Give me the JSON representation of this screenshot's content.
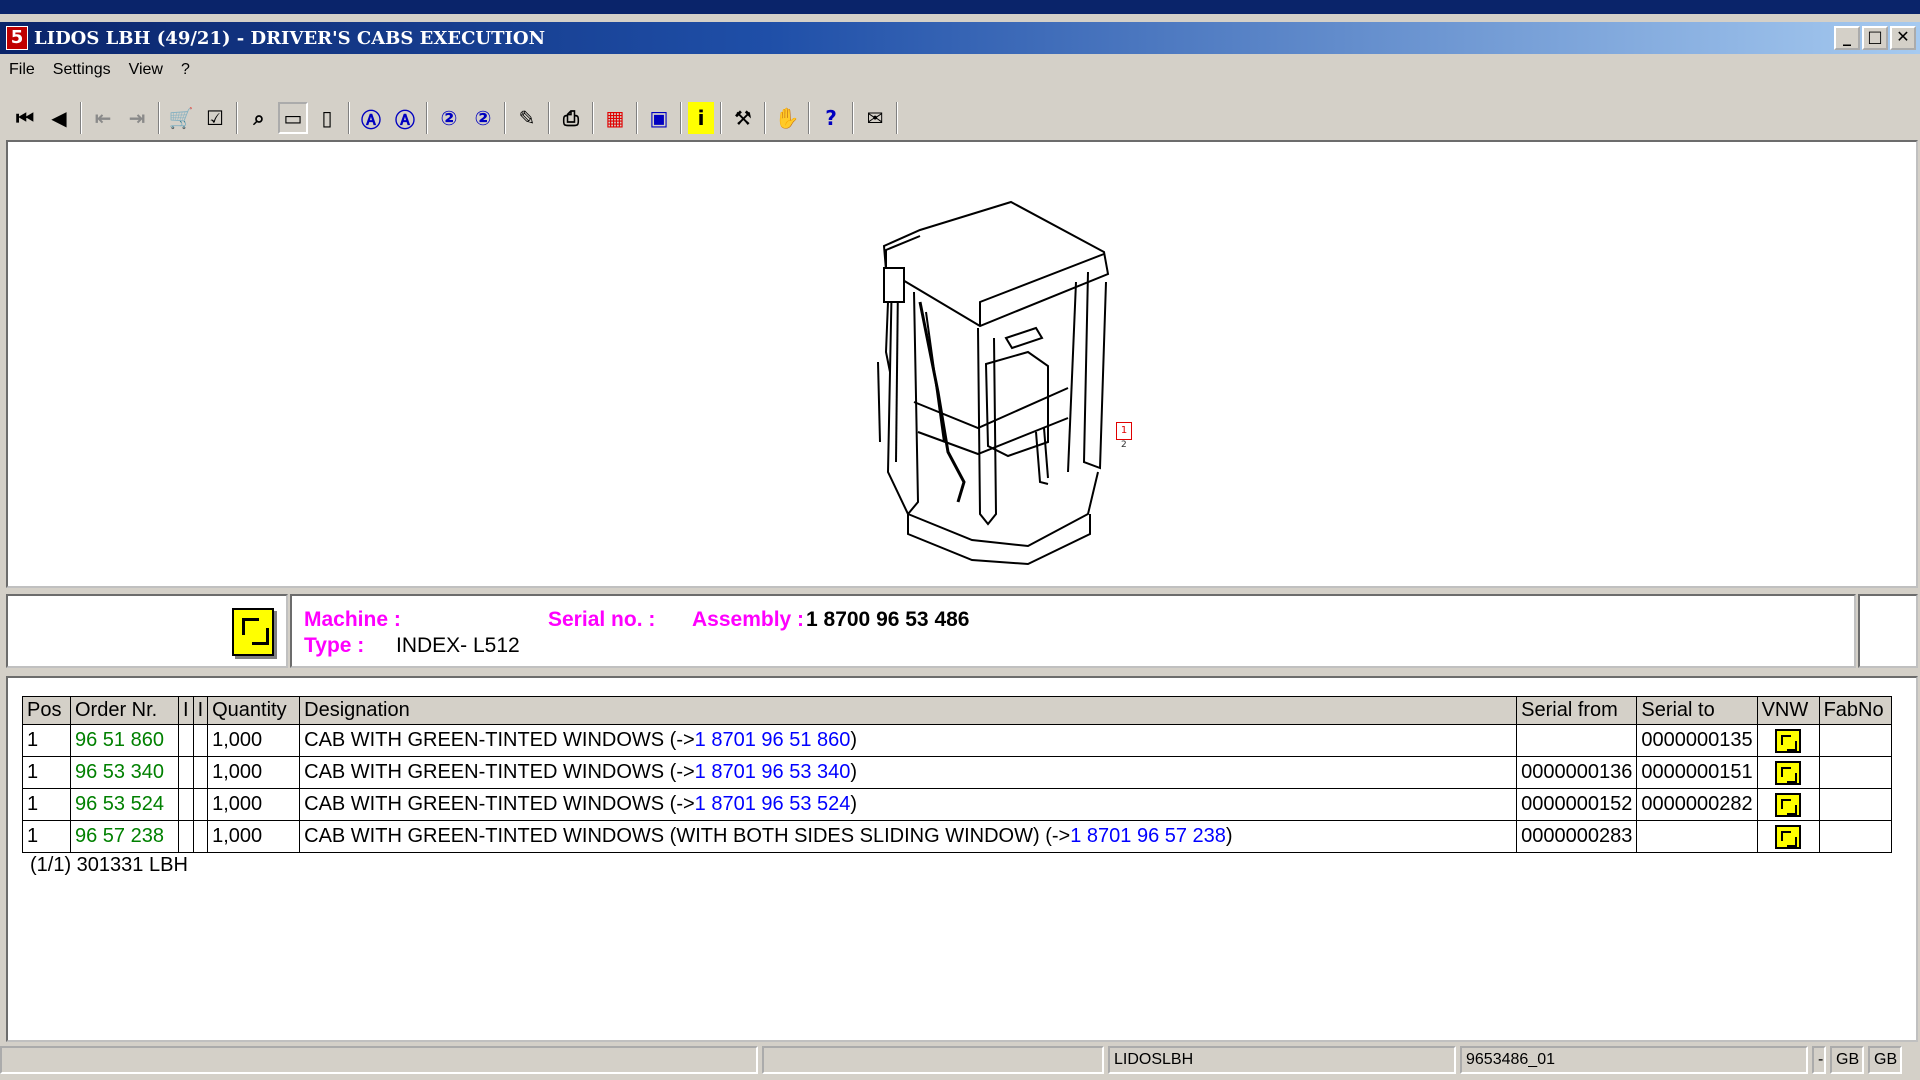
{
  "window": {
    "icon_glyph": "5",
    "title": "LIDOS LBH (49/21) - DRIVER'S CABS EXECUTION",
    "minimize": "_",
    "maximize": "□",
    "close": "✕"
  },
  "menu": [
    "File",
    "Settings",
    "View",
    "?"
  ],
  "toolbar": {
    "buttons": [
      {
        "name": "first-record-icon",
        "glyph": "⏮"
      },
      {
        "name": "previous-record-icon",
        "glyph": "◀"
      },
      {
        "name": "back-disabled-icon",
        "glyph": "⇤"
      },
      {
        "name": "forward-disabled-icon",
        "glyph": "⇥"
      },
      {
        "name": "cart-icon",
        "glyph": "🛒"
      },
      {
        "name": "checklist-icon",
        "glyph": "☑"
      },
      {
        "name": "zoom-icon",
        "glyph": "⌕"
      },
      {
        "name": "page-icon",
        "glyph": "▭"
      },
      {
        "name": "page-flip-icon",
        "glyph": "▯"
      },
      {
        "name": "search-a-icon",
        "glyph": "Ⓐ"
      },
      {
        "name": "search-a-next-icon",
        "glyph": "Ⓐ"
      },
      {
        "name": "search-2-icon",
        "glyph": "②"
      },
      {
        "name": "search-2-next-icon",
        "glyph": "②"
      },
      {
        "name": "edit-icon",
        "glyph": "✎"
      },
      {
        "name": "print-icon",
        "glyph": "⎙"
      },
      {
        "name": "grid-icon",
        "glyph": "▦"
      },
      {
        "name": "select-icon",
        "glyph": "▣"
      },
      {
        "name": "info-icon",
        "glyph": "i"
      },
      {
        "name": "tools-icon",
        "glyph": "⚒"
      },
      {
        "name": "handshake-icon",
        "glyph": "✋"
      },
      {
        "name": "lidos-help-icon",
        "glyph": "?"
      },
      {
        "name": "mail-icon",
        "glyph": "✉"
      }
    ]
  },
  "drawing": {
    "callout_top": "1",
    "callout_bottom": "2"
  },
  "info": {
    "machine_label": "Machine :",
    "machine_value": "",
    "serial_label": "Serial no. :",
    "serial_value": "",
    "assembly_label": "Assembly :",
    "assembly_value": "1 8700 96 53 486",
    "type_label": "Type :",
    "type_value": "INDEX- L512"
  },
  "table": {
    "headers": [
      "Pos",
      "Order Nr.",
      "I",
      "I",
      "Quantity",
      "Designation",
      "Serial from",
      "Serial to",
      "VNW",
      "FabNo"
    ],
    "rows": [
      {
        "pos": "1",
        "order": "96 51 860",
        "i1": "",
        "i2": "",
        "qty": "1,000",
        "designation": "CAB WITH GREEN-TINTED WINDOWS (->",
        "ref": "1 8701 96 51 860",
        "close": ")",
        "serial_from": "",
        "serial_to": "0000000135",
        "fabno": ""
      },
      {
        "pos": "1",
        "order": "96 53 340",
        "i1": "",
        "i2": "",
        "qty": "1,000",
        "designation": "CAB WITH GREEN-TINTED WINDOWS (->",
        "ref": "1 8701 96 53 340",
        "close": ")",
        "serial_from": "0000000136",
        "serial_to": "0000000151",
        "fabno": ""
      },
      {
        "pos": "1",
        "order": "96 53 524",
        "i1": "",
        "i2": "",
        "qty": "1,000",
        "designation": "CAB WITH GREEN-TINTED WINDOWS (->",
        "ref": "1 8701 96 53 524",
        "close": ")",
        "serial_from": "0000000152",
        "serial_to": "0000000282",
        "fabno": ""
      },
      {
        "pos": "1",
        "order": "96 57 238",
        "i1": "",
        "i2": "",
        "qty": "1,000",
        "designation": "CAB WITH GREEN-TINTED WINDOWS (WITH BOTH SIDES SLIDING WINDOW) (->",
        "ref": "1 8701 96 57 238",
        "close": ")",
        "serial_from": "0000000283",
        "serial_to": "",
        "fabno": ""
      }
    ],
    "footer": "(1/1) 301331 LBH"
  },
  "status": {
    "s1": "",
    "s2": "",
    "s3": "LIDOSLBH",
    "s4": "9653486_01",
    "s5": "-",
    "s6": "GB",
    "s7": "GB"
  }
}
